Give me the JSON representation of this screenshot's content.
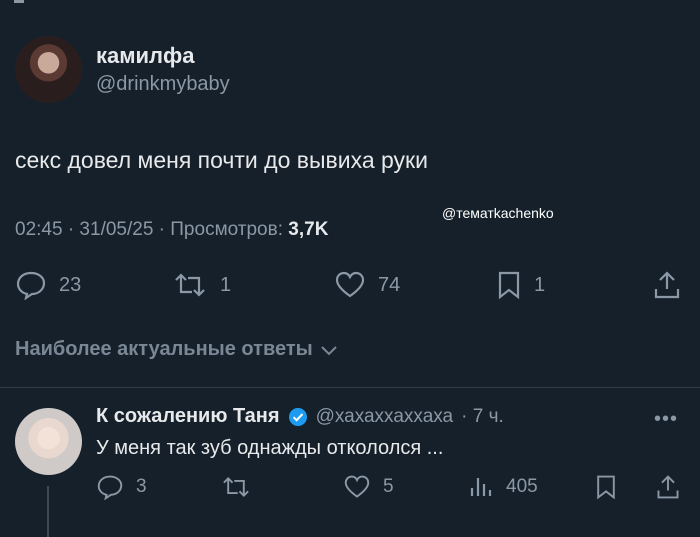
{
  "tweet": {
    "author_name": "камилфа",
    "author_handle": "@drinkmybaby",
    "text": "секс довел меня почти до вывиха руки",
    "timestamp": "02:45 · 31/05/25 · Просмотров:",
    "views": "3,7K",
    "watermark": "@тематkachenko",
    "actions": {
      "replies": "23",
      "retweets": "1",
      "likes": "74",
      "bookmarks": "1"
    }
  },
  "replies_header": {
    "label": "Наиболее актуальные ответы"
  },
  "reply": {
    "author_name": "К сожалению Таня",
    "author_handle": "@хахаххаххаха",
    "time": "· 7 ч.",
    "text": "У меня так зуб однажды откололся ...",
    "actions": {
      "replies": "3",
      "retweets": "",
      "likes": "5",
      "views": "405"
    }
  },
  "colors": {
    "background": "#15202b",
    "text": "#e7e9ea",
    "muted": "#8b98a5",
    "verified": "#1d9bf0"
  }
}
